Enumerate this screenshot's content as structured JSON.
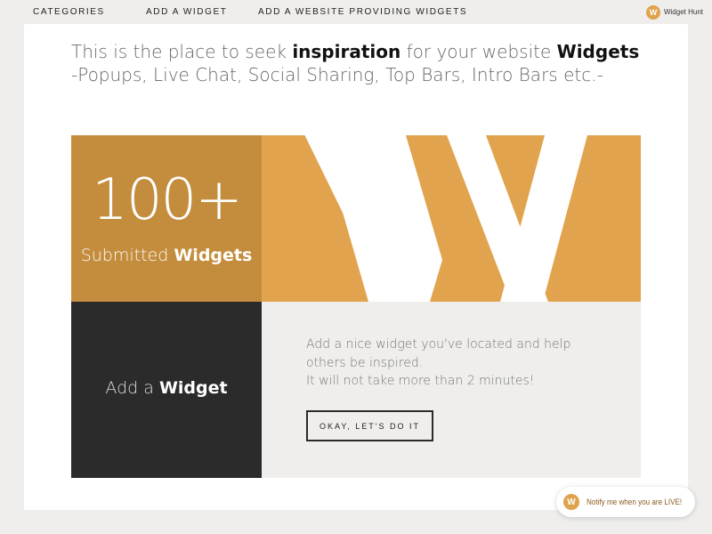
{
  "nav": {
    "links": [
      "Categories",
      "Add a Widget",
      "Add a Website Providing Widgets"
    ],
    "brand": {
      "logo_letter": "W",
      "name": "Widget Hunt"
    }
  },
  "headline": {
    "line1_pre": "This is the place to seek ",
    "line1_bold1": "inspiration",
    "line1_mid": " for your website ",
    "line1_bold2": "Widgets",
    "line2": "-Popups, Live Chat, Social Sharing, Top Bars, Intro Bars etc.-"
  },
  "stats": {
    "number": "100+",
    "label_light": "Submitted ",
    "label_bold": "Widgets"
  },
  "hero": {
    "letter": "W",
    "icon": "w-letter-icon"
  },
  "add": {
    "label_light": "Add a ",
    "label_bold": "Widget",
    "info_lines": [
      "Add a nice widget you've located and help",
      "others be inspired.",
      "It will not take more than 2 minutes!"
    ],
    "button_label": "Okay, let's do it"
  },
  "notify": {
    "logo_letter": "W",
    "text": "Notify me when you are LIVE!"
  },
  "colors": {
    "accent": "#e1a34d",
    "accent_dark": "#c48d3d",
    "dark": "#2b2b2b",
    "background": "#efeeec"
  }
}
